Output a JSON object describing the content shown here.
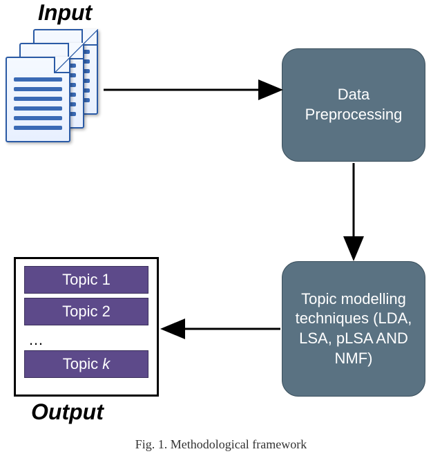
{
  "labels": {
    "input": "Input",
    "output": "Output"
  },
  "boxes": {
    "preprocessing": "Data Preprocessing",
    "topic_modelling": "Topic modelling techniques (LDA, LSA, pLSA AND NMF)"
  },
  "output_topics": {
    "t1": "Topic 1",
    "t2": "Topic 2",
    "ellipsis": "…",
    "tk_prefix": "Topic ",
    "tk_var": "k"
  },
  "caption": "Fig. 1.   Methodological framework"
}
